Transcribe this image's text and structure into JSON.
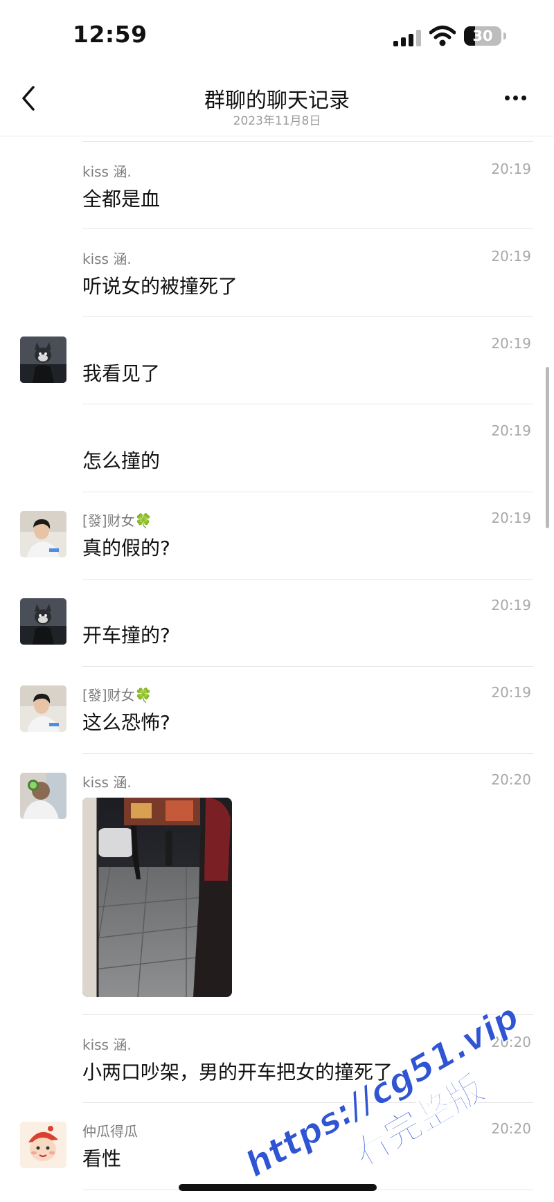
{
  "status_bar": {
    "time": "12:59",
    "battery_level": "30",
    "battery_fraction": 0.3
  },
  "nav": {
    "title": "群聊的聊天记录",
    "subtitle": "2023年11月8日"
  },
  "messages": [
    {
      "sender": "kiss 涵.",
      "time": "20:19",
      "text": "全都是血"
    },
    {
      "sender": "kiss 涵.",
      "time": "20:19",
      "text": "听说女的被撞死了"
    },
    {
      "sender": "",
      "time": "20:19",
      "text": "我看见了"
    },
    {
      "sender": "",
      "time": "20:19",
      "text": "怎么撞的"
    },
    {
      "sender": "[發]财女🍀",
      "time": "20:19",
      "text": "真的假的?"
    },
    {
      "sender": "",
      "time": "20:19",
      "text": "开车撞的?"
    },
    {
      "sender": "[發]财女🍀",
      "time": "20:19",
      "text": "这么恐怖?"
    },
    {
      "sender": "kiss 涵.",
      "time": "20:20",
      "text": ""
    },
    {
      "sender": "kiss 涵.",
      "time": "20:20",
      "text": "小两口吵架，男的开车把女的撞死了"
    },
    {
      "sender": "仲瓜得瓜",
      "time": "20:20",
      "text": "看性"
    }
  ],
  "watermark": {
    "line1": "https://cg51.vip",
    "line2": "看完整版"
  },
  "colors": {
    "watermark": "#2f55d4",
    "clover": "#3bb54a"
  },
  "icons": [
    "back-chevron-icon",
    "more-icon",
    "signal-icon",
    "wifi-icon",
    "battery-icon"
  ]
}
